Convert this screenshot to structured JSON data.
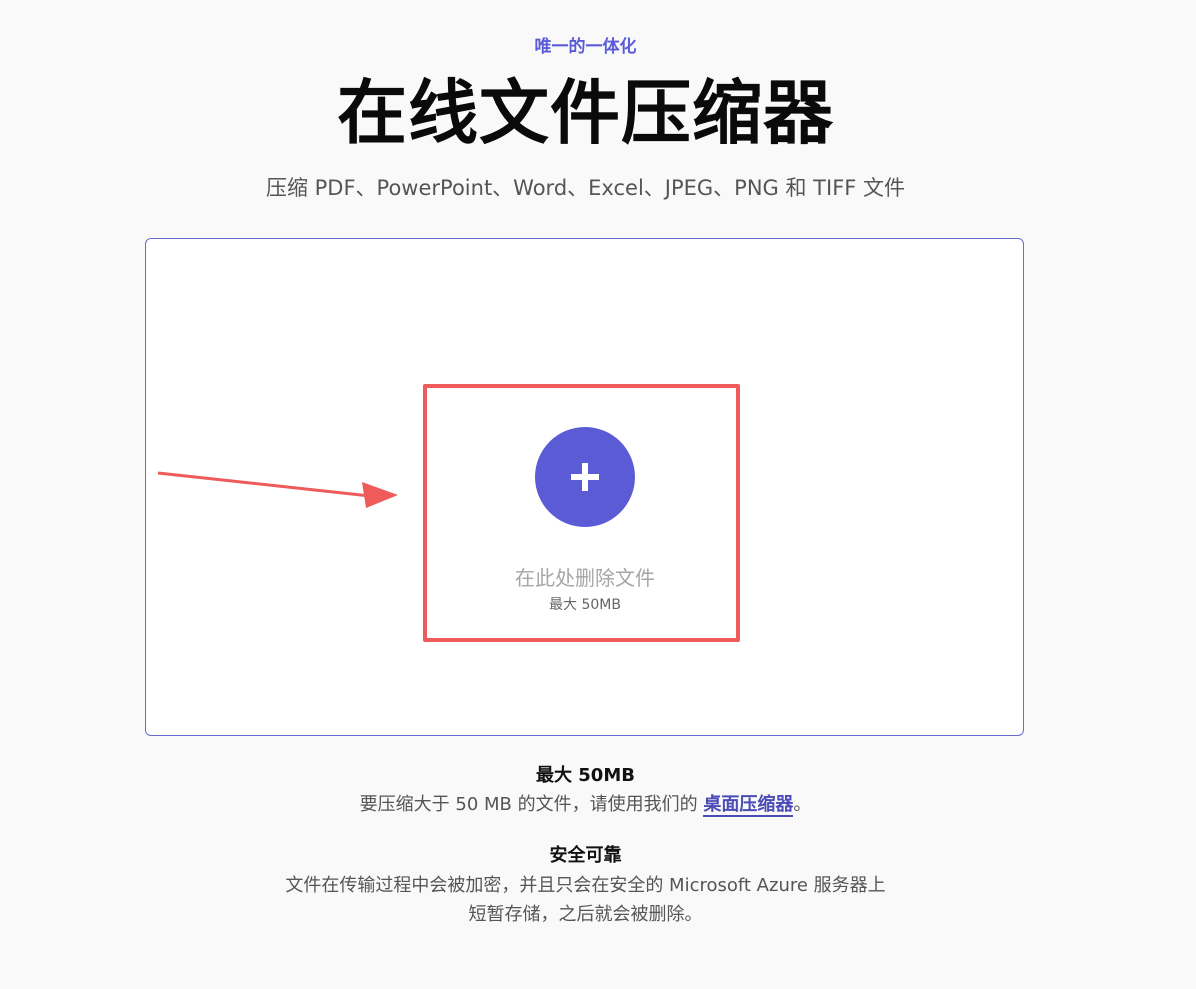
{
  "header": {
    "kicker": "唯一的一体化",
    "title": "在线文件压缩器",
    "subtitle": "压缩 PDF、PowerPoint、Word、Excel、JPEG、PNG 和 TIFF 文件"
  },
  "dropzone": {
    "add_icon": "plus-icon",
    "label": "在此处删除文件",
    "limit": "最大 50MB"
  },
  "info": {
    "size_title": "最大 50MB",
    "size_text_prefix": "要压缩大于 50 MB 的文件，请使用我们的",
    "size_link": "桌面压缩器",
    "size_text_suffix": "。",
    "security_title": "安全可靠",
    "security_text": "文件在传输过程中会被加密，并且只会在安全的 Microsoft Azure 服务器上短暂存储，之后就会被删除。"
  },
  "colors": {
    "accent": "#5b5bd6",
    "annotation": "#ef5a5a",
    "background": "#f9f9f9"
  }
}
